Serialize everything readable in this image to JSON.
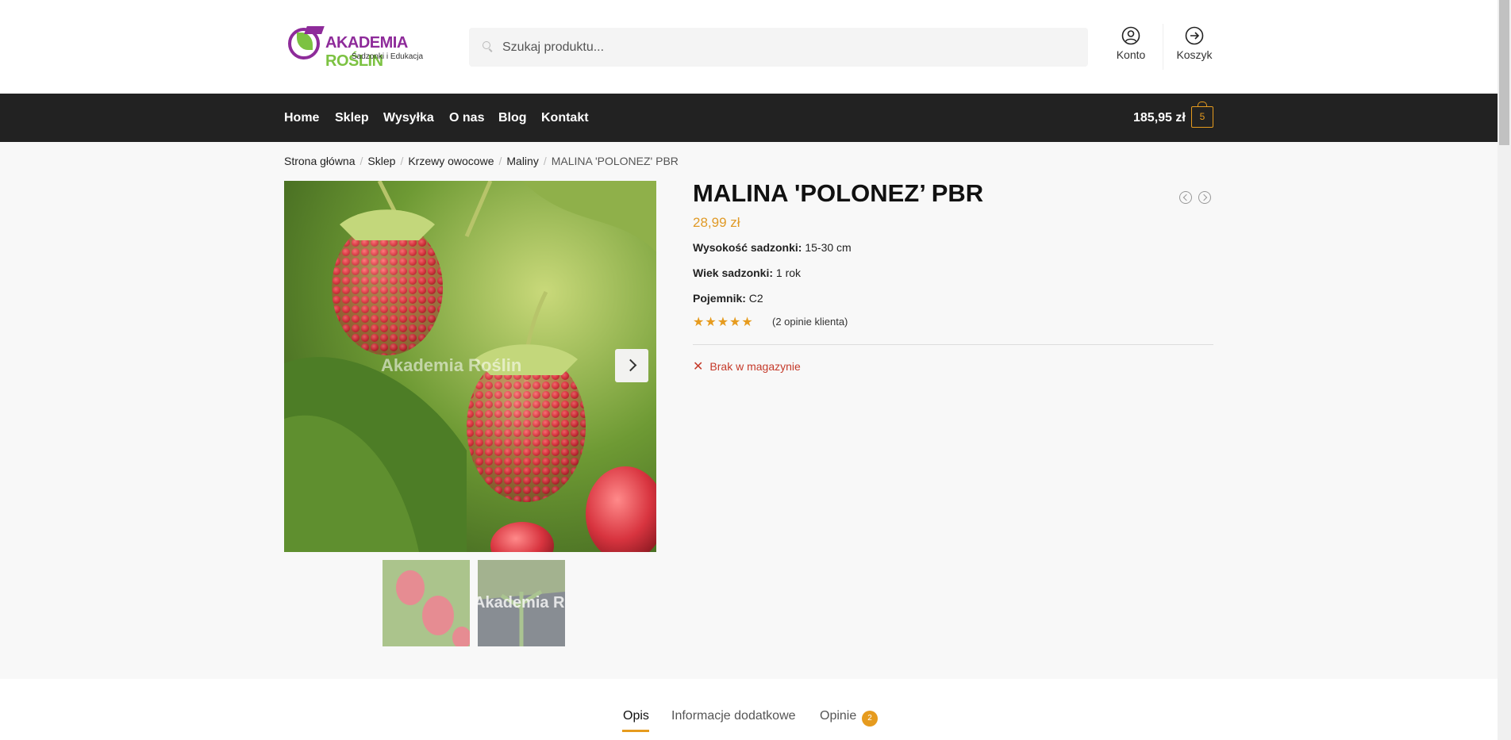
{
  "header": {
    "logo": {
      "name": "AKADEMIA ROŚLIN",
      "tagline": "Sadzonki i Edukacja"
    },
    "search": {
      "placeholder": "Szukaj produktu..."
    },
    "account_label": "Konto",
    "cart_label": "Koszyk"
  },
  "nav": {
    "items": [
      {
        "label": "Home"
      },
      {
        "label": "Sklep"
      },
      {
        "label": "Wysyłka"
      },
      {
        "label": "O nas"
      },
      {
        "label": "Blog"
      },
      {
        "label": "Kontakt"
      }
    ],
    "cart_total": "185,95 zł",
    "cart_count": "5"
  },
  "breadcrumb": {
    "items": [
      {
        "label": "Strona główna"
      },
      {
        "label": "Sklep"
      },
      {
        "label": "Krzewy owocowe"
      },
      {
        "label": "Maliny"
      }
    ],
    "current": "MALINA 'POLONEZ' PBR"
  },
  "product": {
    "title": "MALINA 'POLONEZ’ PBR",
    "price": "28,99 zł",
    "image_watermark": "Akademia Roślin",
    "attributes": [
      {
        "label": "Wysokość sadzonki:",
        "value": "15-30 cm"
      },
      {
        "label": "Wiek sadzonki:",
        "value": "1 rok"
      },
      {
        "label": "Pojemnik:",
        "value": "C2"
      }
    ],
    "rating_stars": 5,
    "reviews_text": "(2 opinie klienta)",
    "stock": "Brak w magazynie"
  },
  "tabs": [
    {
      "label": "Opis",
      "active": true
    },
    {
      "label": "Informacje dodatkowe",
      "active": false
    },
    {
      "label": "Opinie",
      "active": false,
      "count": "2"
    }
  ],
  "colors": {
    "accent": "#e69b1e",
    "price": "#e09a27",
    "out_of_stock": "#c53a2a",
    "navbar": "#222222",
    "logo_purple": "#8e2b9a",
    "logo_green": "#7cc242"
  }
}
